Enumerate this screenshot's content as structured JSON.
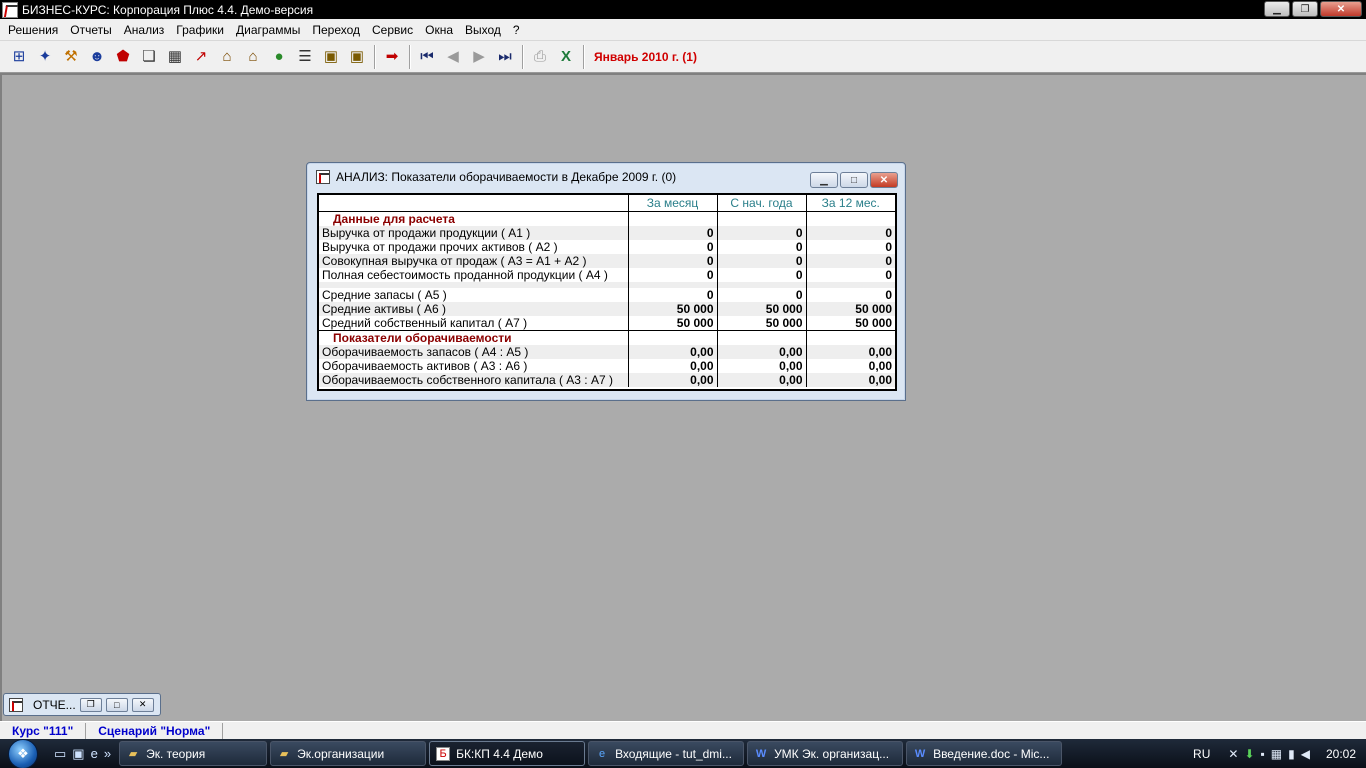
{
  "window": {
    "title": "БИЗНЕС-КУРС: Корпорация Плюс 4.4. Демо-версия",
    "controls": [
      "minimize",
      "restore",
      "close"
    ]
  },
  "menu": [
    "Решения",
    "Отчеты",
    "Анализ",
    "Графики",
    "Диаграммы",
    "Переход",
    "Сервис",
    "Окна",
    "Выход",
    "?"
  ],
  "toolbar": {
    "period_label": "Январь 2010 г. (1)"
  },
  "report": {
    "title": "АНАЛИЗ: Показатели оборачиваемости в Декабре 2009 г. (0)",
    "columns": [
      "За месяц",
      "С нач. года",
      "За 12 мес."
    ],
    "section1": "Данные для расчета",
    "section1_rows": [
      {
        "label": "Выручка от продажи продукции ( А1 )",
        "values": [
          "0",
          "0",
          "0"
        ]
      },
      {
        "label": "Выручка от продажи прочих активов ( А2 )",
        "values": [
          "0",
          "0",
          "0"
        ]
      },
      {
        "label": "Совокупная выручка от продаж ( А3 = А1 + А2 )",
        "values": [
          "0",
          "0",
          "0"
        ]
      },
      {
        "label": "Полная себестоимость проданной продукции ( А4 )",
        "values": [
          "0",
          "0",
          "0"
        ]
      },
      {
        "label": "Средние запасы ( А5 )",
        "values": [
          "0",
          "0",
          "0"
        ]
      },
      {
        "label": "Средние активы ( А6 )",
        "values": [
          "50 000",
          "50 000",
          "50 000"
        ]
      },
      {
        "label": "Средний собственный капитал ( А7 )",
        "values": [
          "50 000",
          "50 000",
          "50 000"
        ]
      }
    ],
    "section2": "Показатели оборачиваемости",
    "section2_rows": [
      {
        "label": "Оборачиваемость запасов ( А4 : А5 )",
        "values": [
          "0,00",
          "0,00",
          "0,00"
        ]
      },
      {
        "label": "Оборачиваемость активов ( А3 : А6 )",
        "values": [
          "0,00",
          "0,00",
          "0,00"
        ]
      },
      {
        "label": "Оборачиваемость собственного капитала ( А3 : А7 )",
        "values": [
          "0,00",
          "0,00",
          "0,00"
        ]
      }
    ]
  },
  "minimized_window": {
    "label": "ОТЧЕ..."
  },
  "status": {
    "course": "Курс \"111\"",
    "scenario": "Сценарий \"Норма\""
  },
  "taskbar": {
    "items": [
      {
        "label": "Эк. теория",
        "icon": "folder-icon"
      },
      {
        "label": "Эк.организации",
        "icon": "folder-icon"
      },
      {
        "label": "БК:КП 4.4 Демо",
        "icon": "app-icon"
      },
      {
        "label": "Входящие - tut_dmi...",
        "icon": "browser-icon"
      },
      {
        "label": "УМК Эк. организац...",
        "icon": "word-icon"
      },
      {
        "label": "Введение.doc - Mic...",
        "icon": "word-icon"
      }
    ],
    "language": "RU",
    "clock": "20:02"
  }
}
